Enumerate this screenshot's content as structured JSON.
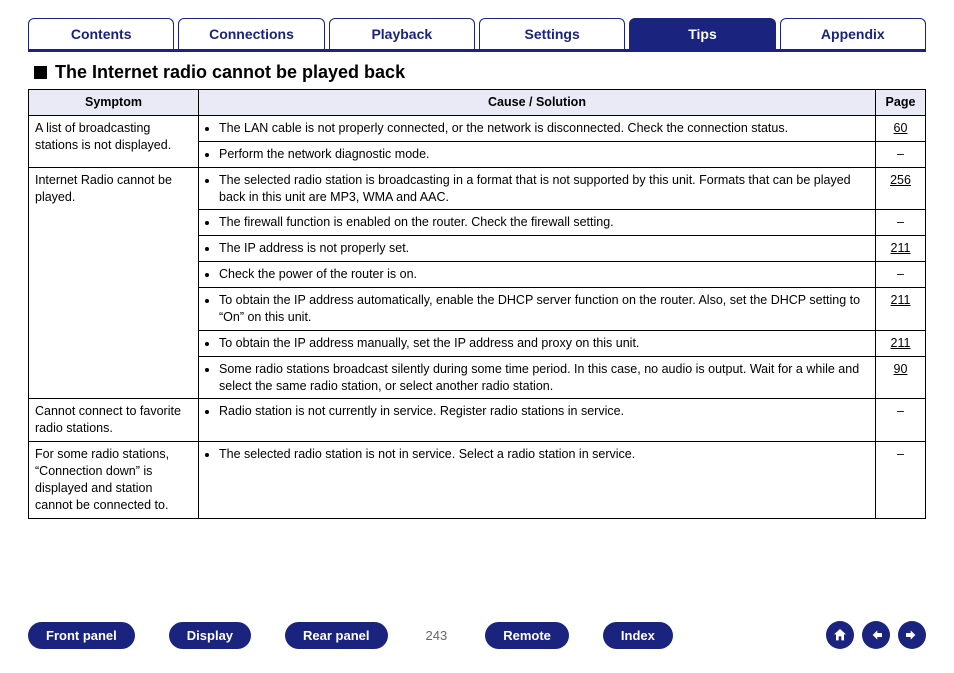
{
  "topnav": {
    "tabs": [
      {
        "label": "Contents"
      },
      {
        "label": "Connections"
      },
      {
        "label": "Playback"
      },
      {
        "label": "Settings"
      },
      {
        "label": "Tips",
        "active": true
      },
      {
        "label": "Appendix"
      }
    ]
  },
  "heading": "The Internet radio cannot be played back",
  "table": {
    "headers": {
      "symptom": "Symptom",
      "cause": "Cause / Solution",
      "page": "Page"
    },
    "rows": [
      {
        "symptom": "A list of broadcasting stations is not displayed.",
        "cause": "The LAN cable is not properly connected, or the network is disconnected. Check the connection status.",
        "page": "60",
        "rowspan": 2
      },
      {
        "cause": "Perform the network diagnostic mode.",
        "page": "–"
      },
      {
        "symptom": "Internet Radio cannot be played.",
        "cause": "The selected radio station is broadcasting in a format that is not supported by this unit. Formats that can be played back in this unit are MP3, WMA and AAC.",
        "page": "256",
        "rowspan": 7
      },
      {
        "cause": "The firewall function is enabled on the router. Check the firewall setting.",
        "page": "–"
      },
      {
        "cause": "The IP address is not properly set.",
        "page": "211"
      },
      {
        "cause": "Check the power of the router is on.",
        "page": "–"
      },
      {
        "cause": "To obtain the IP address automatically, enable the DHCP server function on the router. Also, set the DHCP setting to “On” on this unit.",
        "page": "211"
      },
      {
        "cause": "To obtain the IP address manually, set the IP address and proxy on this unit.",
        "page": "211"
      },
      {
        "cause": "Some radio stations broadcast silently during some time period. In this case, no audio is output. Wait for a while and select the same radio station, or select another radio station.",
        "page": "90"
      },
      {
        "symptom": "Cannot connect to favorite radio stations.",
        "cause": "Radio station is not currently in service. Register radio stations in service.",
        "page": "–",
        "rowspan": 1
      },
      {
        "symptom": "For some radio stations, “Connection down” is displayed and station cannot be connected to.",
        "cause": "The selected radio station is not in service. Select a radio station in service.",
        "page": "–",
        "rowspan": 1
      }
    ]
  },
  "footer": {
    "buttons": {
      "front_panel": "Front panel",
      "display": "Display",
      "rear_panel": "Rear panel",
      "remote": "Remote",
      "index": "Index"
    },
    "page_number": "243"
  }
}
